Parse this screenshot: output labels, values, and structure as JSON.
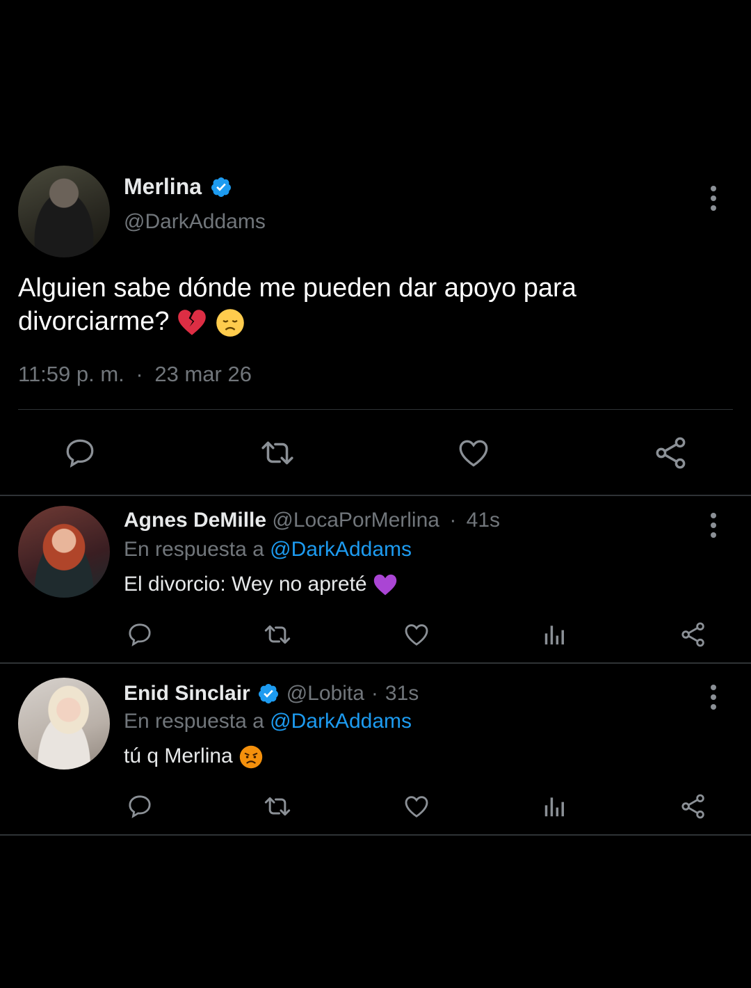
{
  "main_tweet": {
    "name": "Merlina",
    "handle": "@DarkAddams",
    "text": "Alguien sabe dónde me pueden dar apoyo para divorciarme?",
    "emojis": [
      "broken-heart",
      "disappointed-face"
    ],
    "time": "11:59 p. m.",
    "separator": "·",
    "date": "23 mar 26"
  },
  "replies": [
    {
      "name": "Agnes DeMille",
      "handle": "@LocaPorMerlina",
      "separator": "·",
      "age": "41s",
      "reply_prefix": "En respuesta a",
      "reply_to": "@DarkAddams",
      "text": "El divorcio: Wey no apreté",
      "emoji": "purple-heart",
      "verified": false
    },
    {
      "name": "Enid Sinclair",
      "handle": "@Lobita",
      "separator": "·",
      "age": "31s",
      "reply_prefix": "En respuesta a",
      "reply_to": "@DarkAddams",
      "text": "tú q Merlina",
      "emoji": "angry-face",
      "verified": true
    }
  ],
  "colors": {
    "background": "#000000",
    "verified": "#1d9bf0",
    "muted": "#71767b",
    "divider": "#2f3336",
    "mention": "#1d9bf0"
  }
}
